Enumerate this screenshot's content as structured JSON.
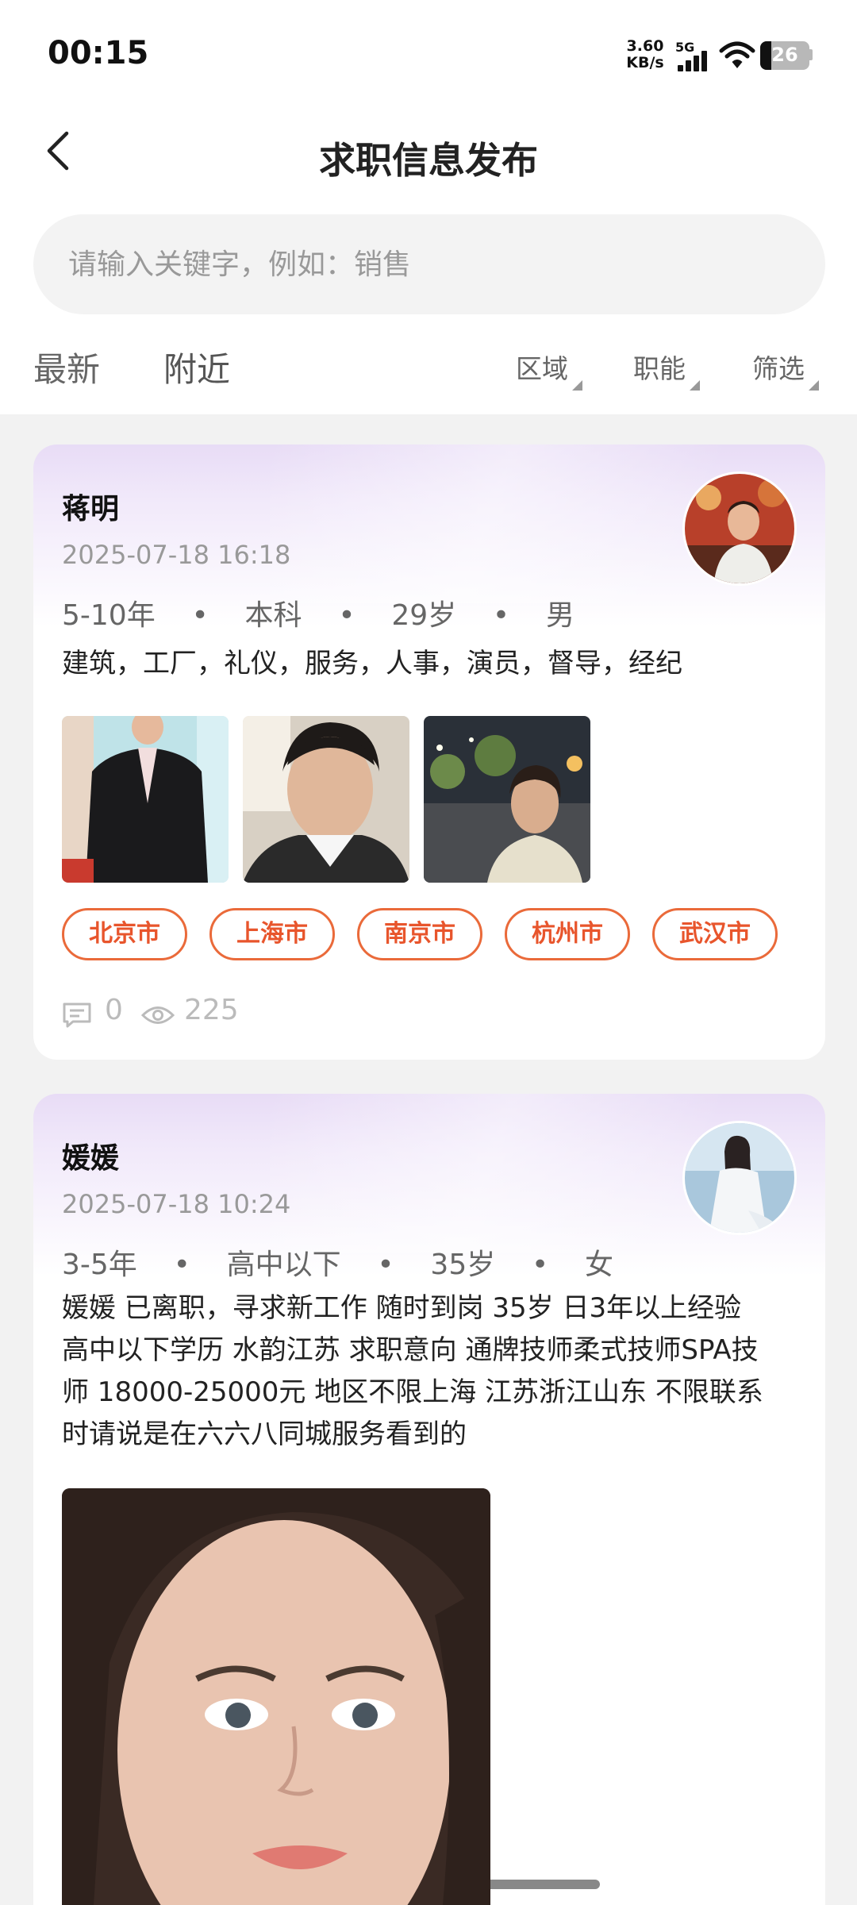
{
  "status_bar": {
    "time": "00:15",
    "net_speed_value": "3.60",
    "net_speed_unit": "KB/s",
    "network_type": "5G",
    "battery": "26"
  },
  "header": {
    "title": "求职信息发布"
  },
  "search": {
    "placeholder": "请输入关键字，例如：销售"
  },
  "tabs": [
    {
      "label": "最新"
    },
    {
      "label": "附近"
    }
  ],
  "filters": [
    {
      "label": "区域"
    },
    {
      "label": "职能"
    },
    {
      "label": "筛选"
    }
  ],
  "posts": [
    {
      "name": "蒋明",
      "date": "2025-07-18 16:18",
      "experience": "5-10年",
      "education": "本科",
      "age": "29岁",
      "gender": "男",
      "description": "建筑，工厂，礼仪，服务，人事，演员，督导，经纪",
      "cities": [
        "北京市",
        "上海市",
        "南京市",
        "杭州市",
        "武汉市"
      ],
      "comments": "0",
      "views": "225"
    },
    {
      "name": "媛媛",
      "date": "2025-07-18 10:24",
      "experience": "3-5年",
      "education": "高中以下",
      "age": "35岁",
      "gender": "女",
      "description_lines": [
        "媛媛 已离职，寻求新工作 随时到岗 35岁 日3年以上经验",
        "高中以下学历 水韵江苏 求职意向 通牌技师柔式技师SPA技",
        "师 18000-25000元 地区不限上海 江苏浙江山东 不限联系",
        "时请说是在六六八同城服务看到的"
      ]
    }
  ],
  "separator": "•"
}
